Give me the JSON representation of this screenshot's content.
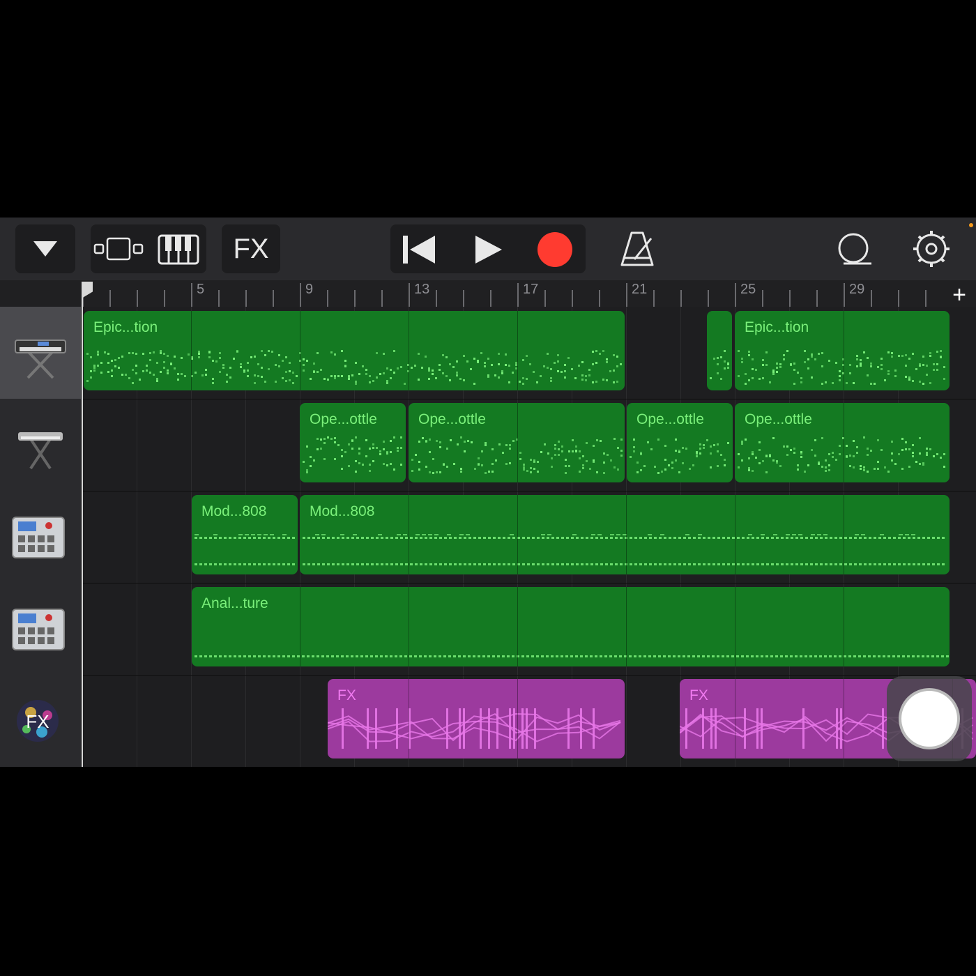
{
  "toolbar": {
    "fx_label": "FX",
    "icons": [
      "chevron-down-icon",
      "tracks-view-icon",
      "keyboard-icon",
      "rewind-icon",
      "play-icon",
      "record-icon",
      "metronome-icon",
      "loop-icon",
      "settings-icon"
    ],
    "record_color": "#ff3b30"
  },
  "ruler": {
    "bar_numbers": [
      "5",
      "9",
      "13",
      "17",
      "21",
      "25",
      "29"
    ],
    "add_label": "+"
  },
  "tracks": [
    {
      "instrument": "keyboard-stand-icon",
      "selected": true
    },
    {
      "instrument": "synth-stand-icon",
      "selected": false
    },
    {
      "instrument": "drum-machine-icon",
      "selected": false
    },
    {
      "instrument": "drum-machine-icon",
      "selected": false
    },
    {
      "instrument": "fx-burst-icon",
      "selected": false
    }
  ],
  "regions": {
    "epic1": "Epic...tion",
    "epic2": "Epic...tion",
    "ope1": "Ope...ottle",
    "ope2": "Ope...ottle",
    "ope3": "Ope...ottle",
    "ope4": "Ope...ottle",
    "mod1": "Mod...808",
    "mod2": "Mod...808",
    "anal": "Anal...ture",
    "fx1": "FX",
    "fx2": "FX"
  },
  "colors": {
    "midi_region": "#147a22",
    "fx_region": "#9c3a9e",
    "note": "#7af07a"
  }
}
